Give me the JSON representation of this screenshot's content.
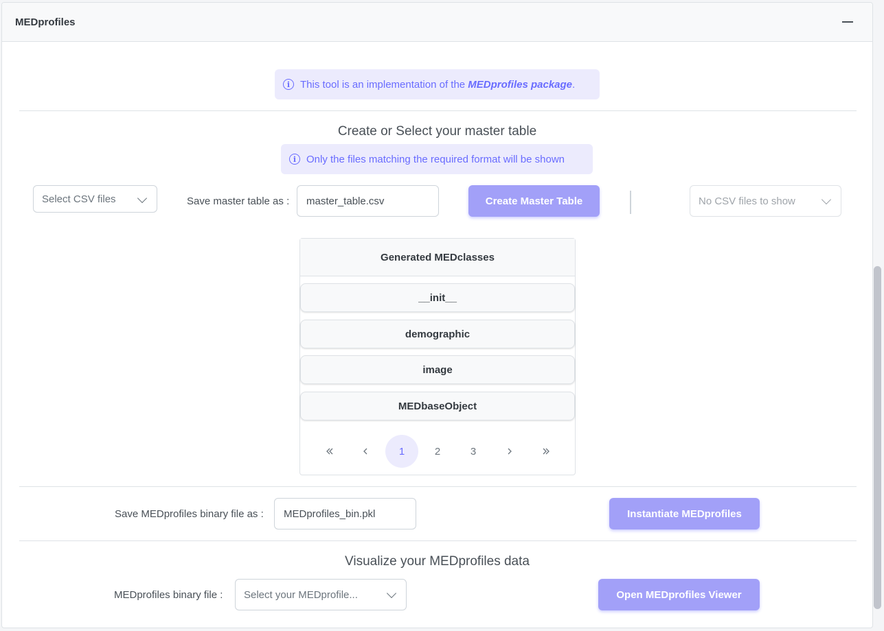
{
  "panel": {
    "title": "MEDprofiles"
  },
  "intro_info": {
    "prefix": "This tool is an implementation of the ",
    "link": "MEDprofiles package",
    "suffix": "."
  },
  "master_table": {
    "heading": "Create or Select your master table",
    "info": "Only the files matching the required format will be shown",
    "csv_select_placeholder": "Select CSV files",
    "save_label": "Save master table as :",
    "save_value": "master_table.csv",
    "create_button": "Create Master Table",
    "existing_select_placeholder": "No CSV files to show"
  },
  "classes": {
    "header": "Generated MEDclasses",
    "items": [
      "__init__",
      "demographic",
      "image",
      "MEDbaseObject"
    ],
    "pages": [
      "1",
      "2",
      "3"
    ],
    "current_page": "1"
  },
  "instantiate": {
    "save_label": "Save MEDprofiles binary file as :",
    "save_value": "MEDprofiles_bin.pkl",
    "button": "Instantiate MEDprofiles"
  },
  "visualize": {
    "heading": "Visualize your MEDprofiles data",
    "file_label": "MEDprofiles binary file :",
    "file_placeholder": "Select your MEDprofile...",
    "button": "Open MEDprofiles Viewer"
  }
}
